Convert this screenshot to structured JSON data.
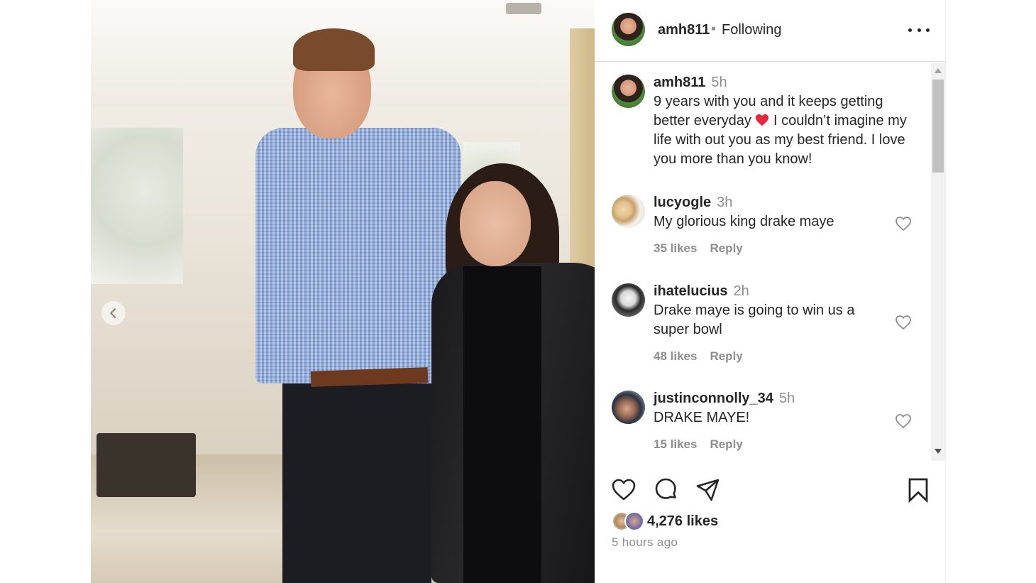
{
  "post": {
    "author": "amh811",
    "follow_status": "Following",
    "separator": "•"
  },
  "caption": {
    "author": "amh811",
    "time": "5h",
    "text_before_emoji": "9 years with you and it keeps getting better everyday",
    "emoji": "red-heart",
    "text_after_emoji": " I couldn’t imagine my life with out you as my best friend. I love you more than you know!"
  },
  "comments": [
    {
      "author": "lucyogle",
      "time": "3h",
      "text": "My glorious king drake maye",
      "likes": "35 likes",
      "reply": "Reply"
    },
    {
      "author": "ihatelucius",
      "time": "2h",
      "text": "Drake maye is going to win us a super bowl",
      "likes": "48 likes",
      "reply": "Reply"
    },
    {
      "author": "justinconnolly_34",
      "time": "5h",
      "text": "DRAKE MAYE!",
      "likes": "15 likes",
      "reply": "Reply"
    }
  ],
  "stats": {
    "likes": "4,276 likes",
    "posted": "5 hours ago"
  },
  "icons": [
    "heart-icon",
    "comment-icon",
    "share-icon",
    "bookmark-icon",
    "more-icon",
    "chevron-left-icon"
  ],
  "colors": {
    "accent_red": "#ed4956",
    "text": "#262626",
    "muted": "#8e8e8e"
  }
}
